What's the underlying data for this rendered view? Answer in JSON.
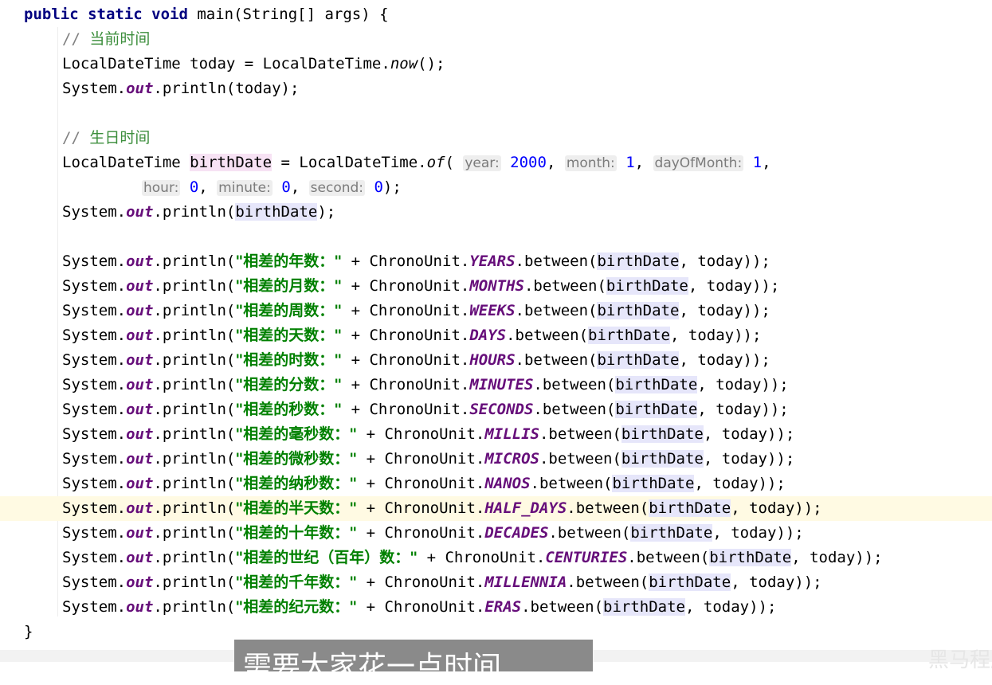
{
  "code": {
    "signature": "public static void main(String[] args) {",
    "comment1": "// 当前时间",
    "now_line": "LocalDateTime today = LocalDateTime.now();",
    "print_today": "System.out.println(today);",
    "comment2": "// 生日时间",
    "birth_line1": "LocalDateTime birthDate = LocalDateTime.of( year: 2000, month: 1, dayOfMonth: 1,",
    "birth_line2": "hour: 0, minute: 0, second: 0);",
    "print_birth": "System.out.println(birthDate);",
    "hints": {
      "year": "year:",
      "year_val": "2000",
      "month": "month:",
      "month_val": "1",
      "day": "dayOfMonth:",
      "day_val": "1",
      "hour": "hour:",
      "hour_val": "0",
      "minute": "minute:",
      "minute_val": "0",
      "second": "second:",
      "second_val": "0"
    },
    "unit_lines": [
      {
        "label": "\"相差的年数：\"",
        "unit": "YEARS"
      },
      {
        "label": "\"相差的月数：\"",
        "unit": "MONTHS"
      },
      {
        "label": "\"相差的周数：\"",
        "unit": "WEEKS"
      },
      {
        "label": "\"相差的天数：\"",
        "unit": "DAYS"
      },
      {
        "label": "\"相差的时数：\"",
        "unit": "HOURS"
      },
      {
        "label": "\"相差的分数：\"",
        "unit": "MINUTES"
      },
      {
        "label": "\"相差的秒数：\"",
        "unit": "SECONDS"
      },
      {
        "label": "\"相差的毫秒数：\"",
        "unit": "MILLIS"
      },
      {
        "label": "\"相差的微秒数：\"",
        "unit": "MICROS"
      },
      {
        "label": "\"相差的纳秒数：\"",
        "unit": "NANOS"
      },
      {
        "label": "\"相差的半天数：\"",
        "unit": "HALF_DAYS"
      },
      {
        "label": "\"相差的十年数：\"",
        "unit": "DECADES"
      },
      {
        "label": "\"相差的世纪（百年）数：\"",
        "unit": "CENTURIES"
      },
      {
        "label": "\"相差的千年数：\"",
        "unit": "MILLENNIA"
      },
      {
        "label": "\"相差的纪元数：\"",
        "unit": "ERAS"
      }
    ],
    "closing_brace": "}"
  },
  "overlay": {
    "subtitle": "需要大家花一点时间",
    "watermark": "黑马程序"
  },
  "colors": {
    "keyword": "#000080",
    "string": "#008000",
    "static_field": "#660e7a",
    "number": "#0000ff",
    "comment": "#808080",
    "caret_row": "#fffae3"
  }
}
